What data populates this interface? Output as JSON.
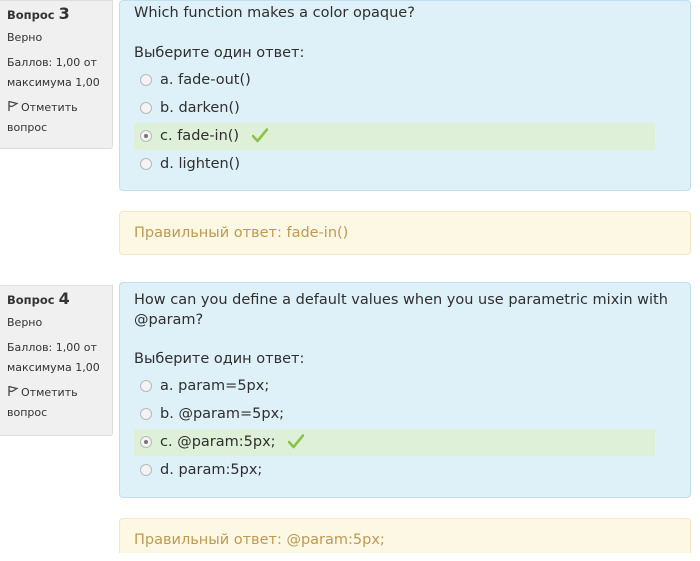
{
  "questions": [
    {
      "label": "Вопрос",
      "number": "3",
      "state": "Верно",
      "grade_line1": "Баллов: 1,00 от",
      "grade_line2": "максимума 1,00",
      "flag_label_line1": "Отметить",
      "flag_label_line2": "вопрос",
      "text": "Which function makes a color opaque?",
      "prompt": "Выберите один ответ:",
      "options": [
        {
          "letter": "a.",
          "text": "fade-out()"
        },
        {
          "letter": "b.",
          "text": "darken()"
        },
        {
          "letter": "c.",
          "text": "fade-in()"
        },
        {
          "letter": "d.",
          "text": "lighten()"
        }
      ],
      "selected_index": 2,
      "correct_answer": "Правильный ответ: fade-in()"
    },
    {
      "label": "Вопрос",
      "number": "4",
      "state": "Верно",
      "grade_line1": "Баллов: 1,00 от",
      "grade_line2": "максимума 1,00",
      "flag_label_line1": "Отметить",
      "flag_label_line2": "вопрос",
      "text": "How can you define a default values when you use parametric mixin with @param?",
      "prompt": "Выберите один ответ:",
      "options": [
        {
          "letter": "a.",
          "text": "param=5px;"
        },
        {
          "letter": "b.",
          "text": "@param=5px;"
        },
        {
          "letter": "c.",
          "text": "@param:5px;"
        },
        {
          "letter": "d.",
          "text": "param:5px;"
        }
      ],
      "selected_index": 2,
      "correct_answer": "Правильный ответ: @param:5px;"
    }
  ],
  "colors": {
    "info_bg": "#f0f0f0",
    "formulation_bg": "#def0f8",
    "correct_bg": "#dff0d8",
    "feedback_bg": "#fcf8e3",
    "feedback_text": "#c09853",
    "check_green": "#8bc34a"
  },
  "icons": {
    "flag": "flag-icon",
    "check": "checkmark-icon"
  }
}
